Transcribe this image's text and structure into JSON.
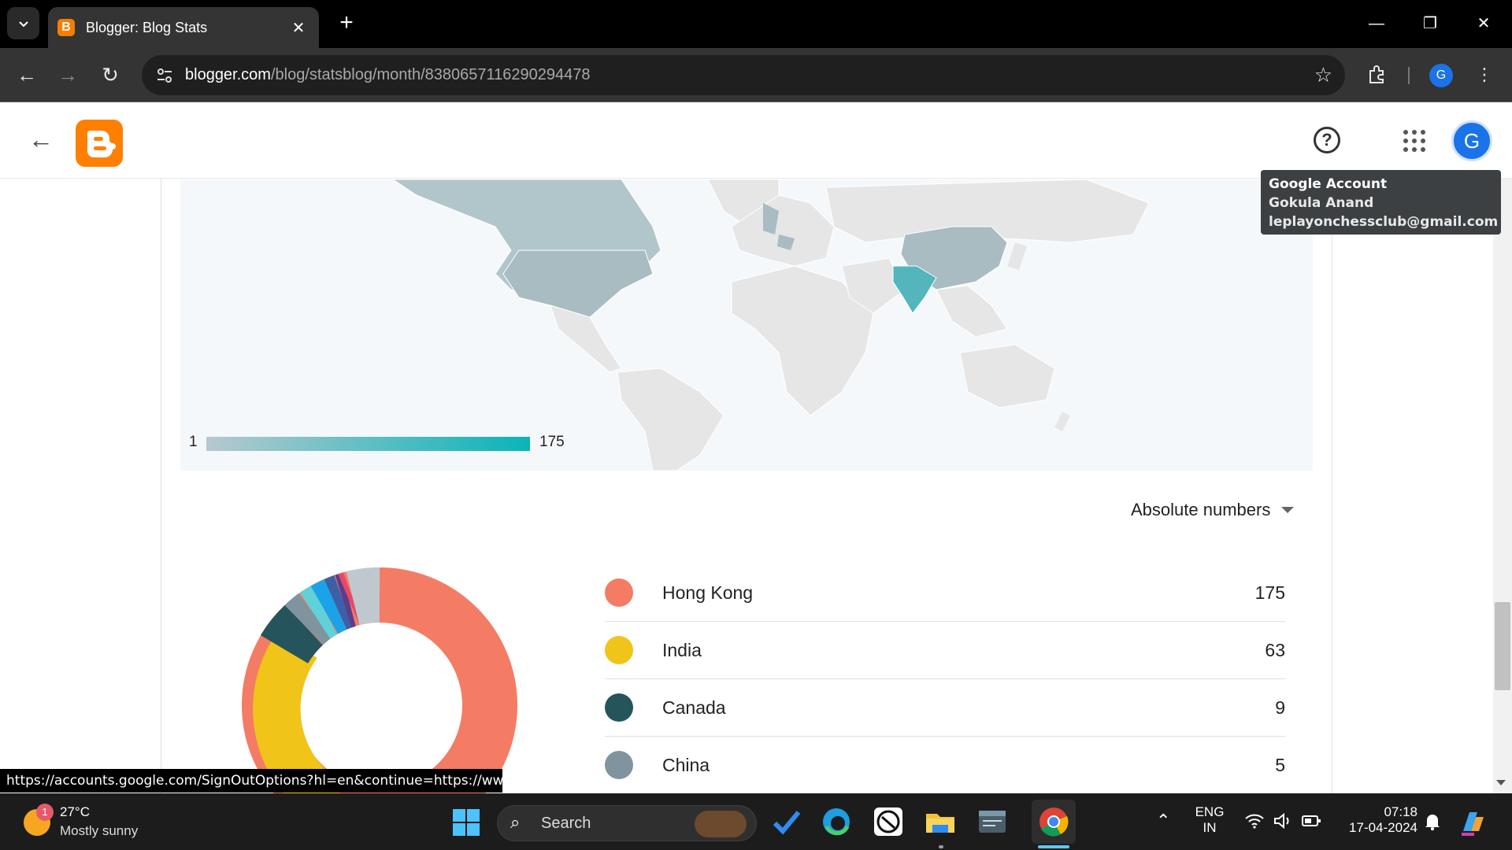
{
  "browser": {
    "tab_title": "Blogger: Blog Stats",
    "url_domain": "blogger.com",
    "url_path": "/blog/statsblog/month/8380657116290294478",
    "profile_initial": "G"
  },
  "page": {
    "avatar_initial": "G",
    "tooltip": {
      "title": "Google Account",
      "name": "Gokula Anand",
      "email": "leplayonchessclub@gmail.com"
    },
    "map_legend": {
      "min": "1",
      "max": "175"
    },
    "view_select": "Absolute numbers",
    "countries": [
      {
        "name": "Hong Kong",
        "count": "175",
        "color": "#f47c64"
      },
      {
        "name": "India",
        "count": "63",
        "color": "#f1c419"
      },
      {
        "name": "Canada",
        "count": "9",
        "color": "#25545d"
      },
      {
        "name": "China",
        "count": "5",
        "color": "#7f949f"
      }
    ],
    "donut_colors": {
      "hong_kong": "#f47c64",
      "india": "#f1c419",
      "canada": "#25545d",
      "china": "#7f949f"
    },
    "status_url": "https://accounts.google.com/SignOutOptions?hl=en&continue=https://ww..."
  },
  "taskbar": {
    "weather_temp": "27°C",
    "weather_desc": "Mostly sunny",
    "weather_badge": "1",
    "search_label": "Search",
    "lang_top": "ENG",
    "lang_bottom": "IN",
    "time": "07:18",
    "date": "17-04-2024"
  }
}
